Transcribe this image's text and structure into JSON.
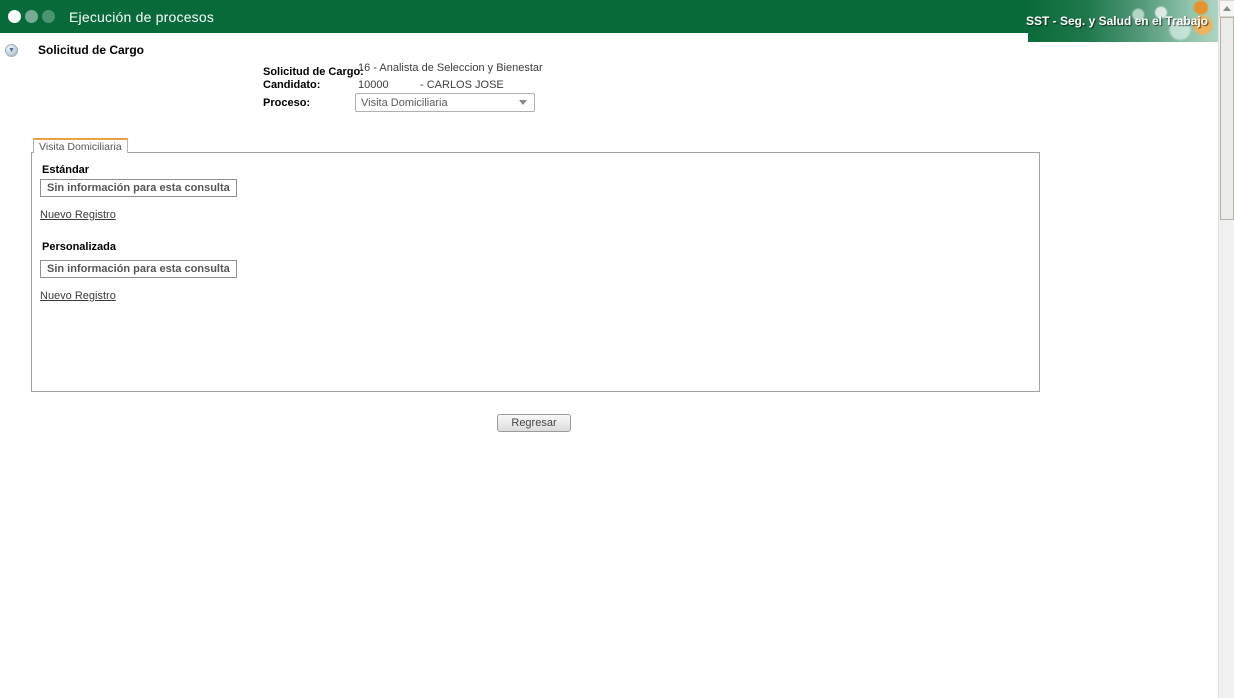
{
  "header": {
    "title": "Ejecución de procesos",
    "brand_text": "SST - Seg. y Salud en el Trabajo",
    "window_dots": [
      "dot-white",
      "dot-light-green",
      "dot-pale-green"
    ]
  },
  "page": {
    "section_title": "Solicitud de Cargo",
    "collapse_icon": "collapse-arrow-down"
  },
  "form": {
    "fields": [
      {
        "label": "Solicitud de Cargo:",
        "value": "16 - Analista de Seleccion y Bienestar"
      },
      {
        "label": "Candidato:",
        "value_code": "10000",
        "value_name": "- CARLOS JOSE"
      },
      {
        "label": "Proceso:",
        "value": "Visita Domiciliaria"
      }
    ]
  },
  "tabs": [
    {
      "label": "Visita Domiciliaria",
      "active": true
    }
  ],
  "panel": {
    "sections": [
      {
        "title": "Estándar",
        "empty_message": "Sin información para esta consulta",
        "link_label": "Nuevo Registro"
      },
      {
        "title": "Personalizada",
        "empty_message": "Sin información para esta consulta",
        "link_label": "Nuevo Registro"
      }
    ]
  },
  "actions": {
    "back_label": "Regresar"
  },
  "colors": {
    "header_green": "#076b39",
    "tab_accent": "#e9a33c",
    "panel_border": "#a3a3a3",
    "link_color": "#3b3b3b"
  }
}
